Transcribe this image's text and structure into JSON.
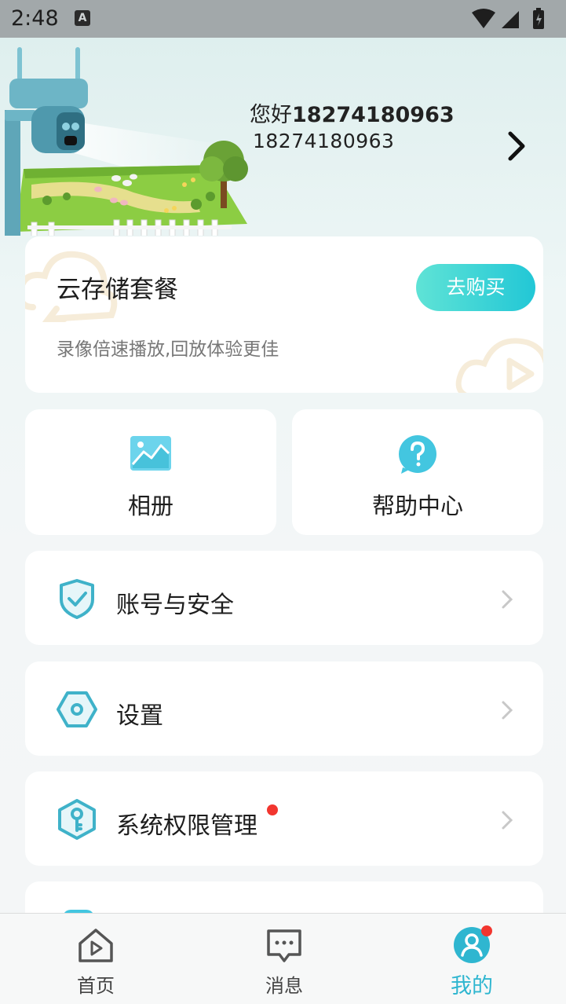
{
  "status_bar": {
    "time": "2:48",
    "notification_letter": "A"
  },
  "profile": {
    "greeting_prefix": "您好",
    "username": "18274180963",
    "phone": "18274180963"
  },
  "cloud_storage": {
    "title": "云存储套餐",
    "subtitle": "录像倍速播放,回放体验更佳",
    "buy_label": "去购买"
  },
  "tiles": {
    "album_label": "相册",
    "help_label": "帮助中心"
  },
  "menu": {
    "account_security": "账号与安全",
    "settings": "设置",
    "permissions": "系统权限管理"
  },
  "bottom_nav": {
    "home": "首页",
    "messages": "消息",
    "mine": "我的"
  },
  "colors": {
    "accent": "#2fb6d0",
    "badge": "#f2362f"
  }
}
